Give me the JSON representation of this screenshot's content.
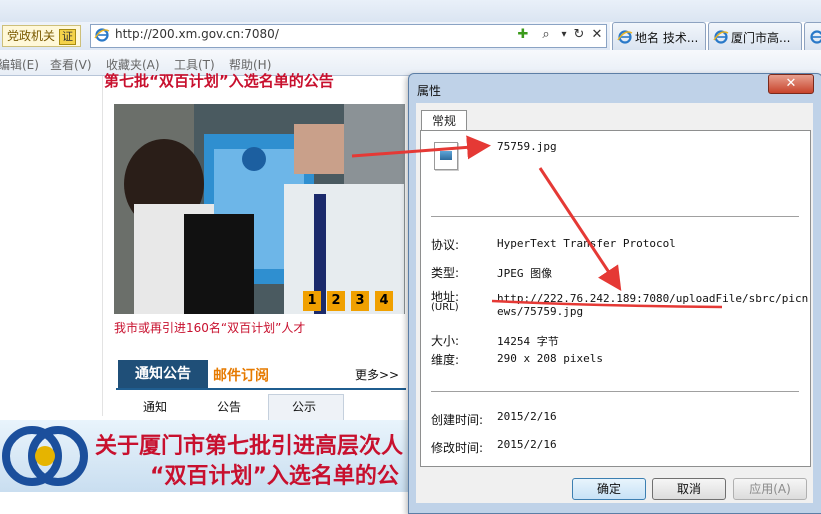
{
  "browser": {
    "site_badge": "党政机关",
    "site_badge_cert": "证",
    "url": "http://200.xm.gov.cn:7080/",
    "tabs": [
      {
        "label": "地名 技术..."
      },
      {
        "label": "厦门市高..."
      }
    ],
    "menu": [
      "编辑(E)",
      "查看(V)",
      "收藏夹(A)",
      "工具(T)",
      "帮助(H)"
    ]
  },
  "page": {
    "headline": "第七批“双百计划”入选名单的公告",
    "photo_numbers": [
      "1",
      "2",
      "3",
      "4"
    ],
    "caption": "我市或再引进160名“双百计划”人才",
    "tabs": {
      "notice": "通知公告",
      "mail": "邮件订阅",
      "more": "更多>>"
    },
    "subtabs": [
      "通知",
      "公告",
      "公示"
    ],
    "banner_line1": "关于厦门市第七批引进高层次人",
    "banner_line2": "“双百计划”入选名单的公"
  },
  "dialog": {
    "title": "属性",
    "close": "✕",
    "tab": "常规",
    "filename": "75759.jpg",
    "protocol_label": "协议:",
    "protocol_value": "HyperText Transfer Protocol",
    "type_label": "类型:",
    "type_value": "JPEG 图像",
    "address_label": "地址:",
    "address_label_sub": "(URL)",
    "address_value_line1": "http://222.76.242.189:7080/uploadFile/sbrc/picn",
    "address_value_line2": "ews/75759.jpg",
    "size_label": "大小:",
    "size_value": "14254 字节",
    "dim_label": "维度:",
    "dim_value": "290  x  208  pixels",
    "created_label": "创建时间:",
    "created_value": "2015/2/16",
    "modified_label": "修改时间:",
    "modified_value": "2015/2/16",
    "buttons": {
      "ok": "确定",
      "cancel": "取消",
      "apply": "应用(A)"
    }
  },
  "colors": {
    "accent_red": "#c8102e",
    "annotation_red": "#e53935",
    "notice_tab": "#1f4f78",
    "mail_orange": "#e67a00"
  }
}
